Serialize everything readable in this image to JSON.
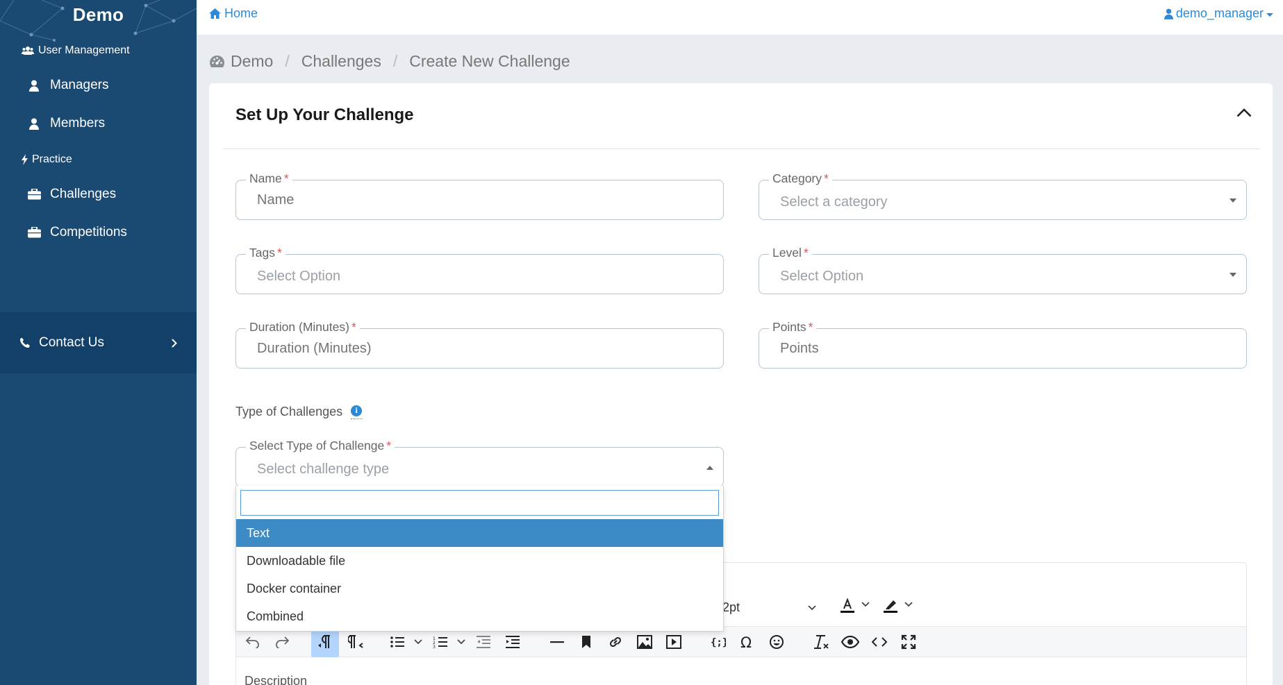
{
  "sidebar": {
    "brand": "Demo",
    "section_user_management": "User Management",
    "items_user": [
      {
        "label": "Managers",
        "icon": "user-icon"
      },
      {
        "label": "Members",
        "icon": "user-icon"
      }
    ],
    "section_practice": "Practice",
    "items_practice": [
      {
        "label": "Challenges",
        "icon": "briefcase-icon"
      },
      {
        "label": "Competitions",
        "icon": "briefcase-icon"
      }
    ],
    "contact": "Contact Us"
  },
  "topbar": {
    "home": "Home",
    "user": "demo_manager"
  },
  "breadcrumb": [
    "Demo",
    "Challenges",
    "Create New Challenge"
  ],
  "card": {
    "title": "Set Up Your Challenge"
  },
  "form": {
    "name": {
      "label": "Name",
      "placeholder": "Name"
    },
    "category": {
      "label": "Category",
      "placeholder": "Select a category"
    },
    "tags": {
      "label": "Tags",
      "placeholder": "Select Option"
    },
    "level": {
      "label": "Level",
      "placeholder": "Select Option"
    },
    "duration": {
      "label": "Duration (Minutes)",
      "placeholder": "Duration (Minutes)"
    },
    "points": {
      "label": "Points",
      "placeholder": "Points"
    },
    "required_mark": "*",
    "type_heading": "Type of Challenges",
    "type_select": {
      "label": "Select Type of Challenge",
      "placeholder": "Select challenge type"
    }
  },
  "dropdown": {
    "search_value": "",
    "options": [
      "Text",
      "Downloadable file",
      "Docker container",
      "Combined"
    ],
    "selected": "Text"
  },
  "editor": {
    "font_size": "2pt",
    "description_label": "Description"
  },
  "colors": {
    "sidebar_bg": "#1a4a72",
    "accent": "#2a8ad8",
    "selected_option": "#3d8bc4",
    "required": "#e05555"
  }
}
